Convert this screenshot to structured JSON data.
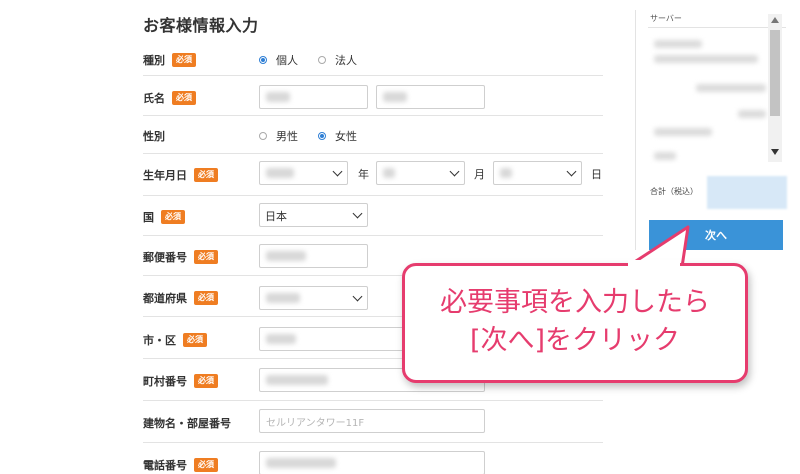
{
  "form": {
    "title": "お客様情報入力",
    "required_badge": "必須",
    "fields": {
      "type": {
        "label": "種別",
        "options": [
          "個人",
          "法人"
        ],
        "selected": "個人"
      },
      "name": {
        "label": "氏名"
      },
      "gender": {
        "label": "性別",
        "options": [
          "男性",
          "女性"
        ],
        "selected": "女性"
      },
      "birthdate": {
        "label": "生年月日",
        "unit_year": "年",
        "unit_month": "月",
        "unit_day": "日"
      },
      "country": {
        "label": "国",
        "value": "日本"
      },
      "postal": {
        "label": "郵便番号"
      },
      "prefecture": {
        "label": "都道府県"
      },
      "city": {
        "label": "市・区"
      },
      "town": {
        "label": "町村番号"
      },
      "building": {
        "label": "建物名・部屋番号",
        "placeholder": "セルリアンタワー11F"
      },
      "phone": {
        "label": "電話番号"
      }
    }
  },
  "sidebar": {
    "server_label": "サーバー",
    "total_label": "合計（税込）",
    "next_button": "次へ"
  },
  "callout": {
    "line1": "必要事項を入力したら",
    "line2": "[次へ]をクリック"
  },
  "colors": {
    "required_badge": "#ef7d22",
    "primary_button": "#3a93d8",
    "callout": "#e63c6e",
    "radio_selected": "#2f7fd5"
  }
}
